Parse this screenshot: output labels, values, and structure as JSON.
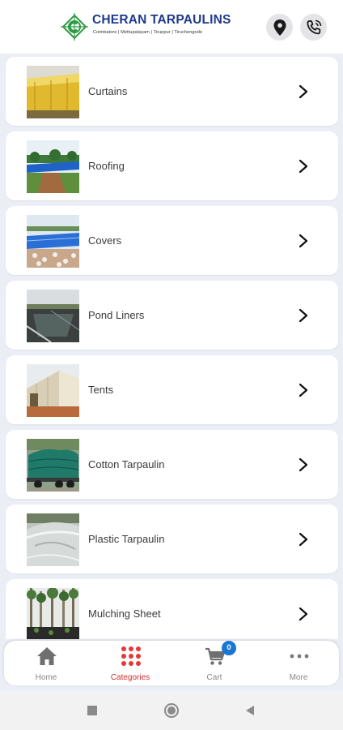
{
  "header": {
    "brand_title": "CHERAN TARPAULINS",
    "brand_subtitle": "Coimbatore | Mettupalayam | Tiruppur | Tiruchengode",
    "location_icon": "location-pin-icon",
    "call_icon": "phone-call-icon"
  },
  "categories": [
    {
      "label": "Curtains",
      "thumb": "curtains-photo"
    },
    {
      "label": "Roofing",
      "thumb": "roofing-photo"
    },
    {
      "label": "Covers",
      "thumb": "covers-photo"
    },
    {
      "label": "Pond Liners",
      "thumb": "pond-liners-photo"
    },
    {
      "label": "Tents",
      "thumb": "tents-photo"
    },
    {
      "label": "Cotton Tarpaulin",
      "thumb": "cotton-tarpaulin-photo"
    },
    {
      "label": "Plastic Tarpaulin",
      "thumb": "plastic-tarpaulin-photo"
    },
    {
      "label": "Mulching Sheet",
      "thumb": "mulching-sheet-photo"
    }
  ],
  "bottom_nav": {
    "items": [
      {
        "label": "Home",
        "icon": "home-icon",
        "active": false
      },
      {
        "label": "Categories",
        "icon": "grid-dots-icon",
        "active": true
      },
      {
        "label": "Cart",
        "icon": "cart-icon",
        "active": false
      },
      {
        "label": "More",
        "icon": "more-dots-icon",
        "active": false
      }
    ],
    "cart_count": "0"
  },
  "colors": {
    "brand_blue": "#1f3a8a",
    "brand_green": "#2e9a45",
    "active_red": "#d32f2f",
    "badge_blue": "#1976d2",
    "background": "#eceef6"
  },
  "system_nav": [
    "square-recents-icon",
    "circle-home-icon",
    "triangle-back-icon"
  ]
}
